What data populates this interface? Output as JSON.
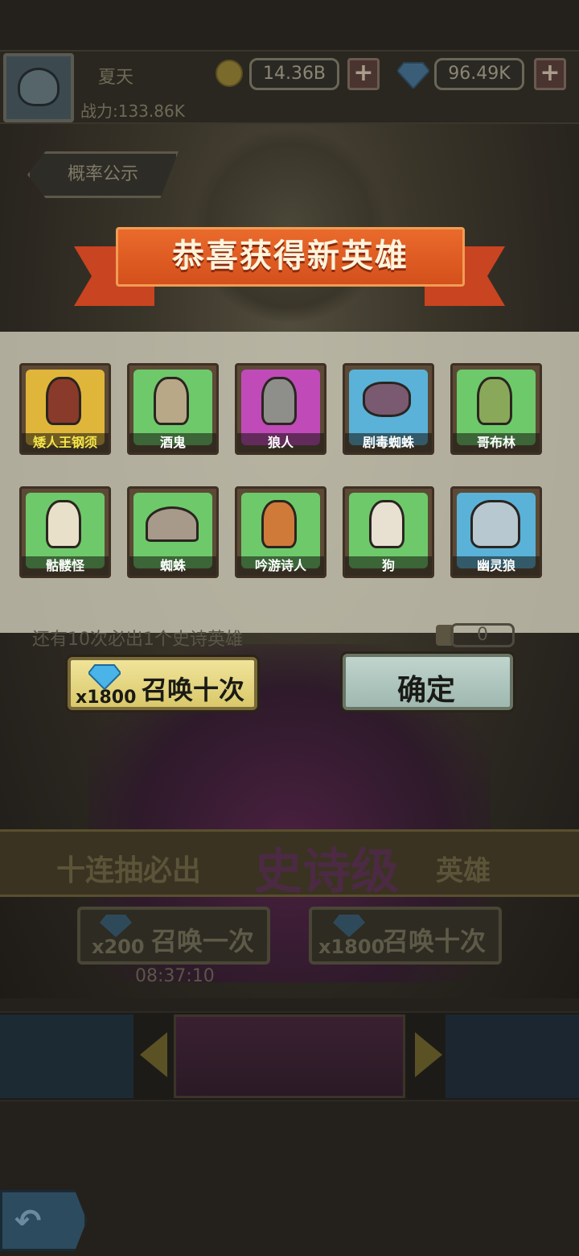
{
  "player": {
    "name": "夏天",
    "power": "战力:133.86K"
  },
  "currency": {
    "gold": "14.36B",
    "diamonds": "96.49K",
    "add_label": "+"
  },
  "probability_button": "概率公示",
  "banner_title": "恭喜获得新英雄",
  "heroes": [
    {
      "name": "矮人王钢须",
      "rarity_color": "#f3e54a"
    },
    {
      "name": "酒鬼"
    },
    {
      "name": "狼人"
    },
    {
      "name": "剧毒蜘蛛"
    },
    {
      "name": "哥布林"
    },
    {
      "name": "骷髅怪"
    },
    {
      "name": "蜘蛛"
    },
    {
      "name": "吟游诗人"
    },
    {
      "name": "狗"
    },
    {
      "name": "幽灵狼"
    }
  ],
  "guarantee_text": "还有10次必出1个史诗英雄",
  "ticket_count": "0",
  "summon_ten": {
    "cost": "x1800",
    "label": "召唤十次"
  },
  "confirm_label": "确定",
  "epic_banner": {
    "prefix": "十连抽必出",
    "highlight": "史诗级",
    "suffix": "英雄"
  },
  "summon_once_bottom": {
    "cost": "x200",
    "label": "召唤一次"
  },
  "summon_ten_bottom": {
    "cost": "x1800",
    "label": "召唤十次"
  },
  "timer": "08:37:10",
  "icons": [
    "avatar-icon",
    "coin-icon",
    "diamond-icon",
    "plus-icon",
    "back-arrow-icon",
    "chevron-left-icon",
    "chevron-right-icon",
    "scroll-icon"
  ]
}
